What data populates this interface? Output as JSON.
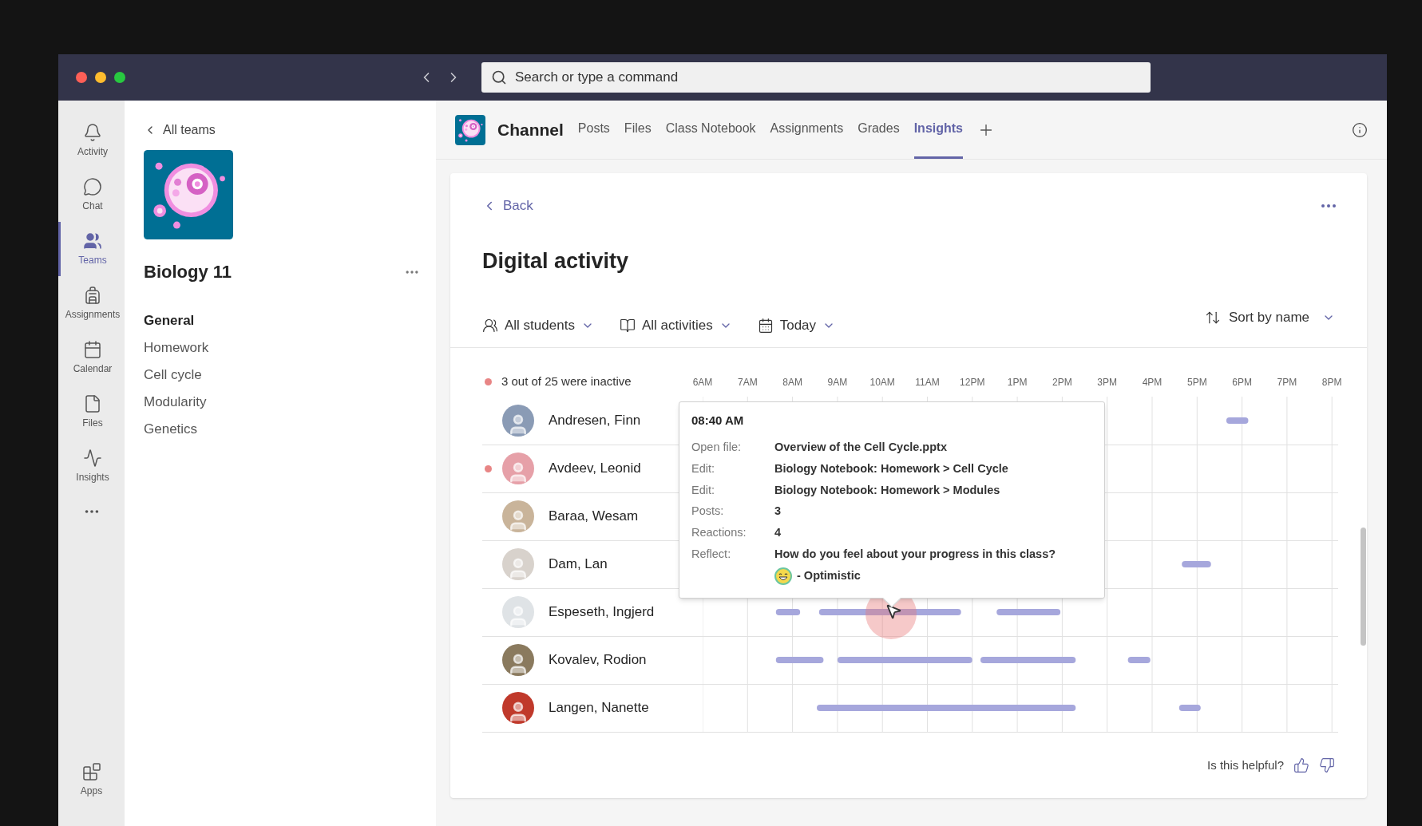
{
  "search": {
    "placeholder": "Search or type a command"
  },
  "rail": {
    "items": [
      {
        "label": "Activity",
        "kind": "bell",
        "selected": false
      },
      {
        "label": "Chat",
        "kind": "chat",
        "selected": false
      },
      {
        "label": "Teams",
        "kind": "teams",
        "selected": true
      },
      {
        "label": "Assignments",
        "kind": "backpack",
        "selected": false
      },
      {
        "label": "Calendar",
        "kind": "calendar",
        "selected": false
      },
      {
        "label": "Files",
        "kind": "file",
        "selected": false
      },
      {
        "label": "Insights",
        "kind": "pulse",
        "selected": false
      }
    ],
    "bottom": {
      "label": "Apps"
    }
  },
  "team": {
    "back": "All teams",
    "name": "Biology 11",
    "channels": [
      {
        "label": "General",
        "selected": true
      },
      {
        "label": "Homework",
        "selected": false
      },
      {
        "label": "Cell cycle",
        "selected": false
      },
      {
        "label": "Modularity",
        "selected": false
      },
      {
        "label": "Genetics",
        "selected": false
      }
    ]
  },
  "header": {
    "title": "Channel",
    "tabs": [
      {
        "label": "Posts",
        "selected": false
      },
      {
        "label": "Files",
        "selected": false
      },
      {
        "label": "Class Notebook",
        "selected": false
      },
      {
        "label": "Assignments",
        "selected": false
      },
      {
        "label": "Grades",
        "selected": false
      },
      {
        "label": "Insights",
        "selected": true
      }
    ]
  },
  "card": {
    "back": "Back",
    "title": "Digital activity",
    "filters": [
      {
        "label": "All students",
        "kind": "students"
      },
      {
        "label": "All activities",
        "kind": "activities"
      },
      {
        "label": "Today",
        "kind": "date"
      }
    ],
    "sort": "Sort by name",
    "summary": "3 out of 25 were inactive",
    "hours": [
      "6AM",
      "7AM",
      "8AM",
      "9AM",
      "10AM",
      "11AM",
      "12PM",
      "1PM",
      "2PM",
      "3PM",
      "4PM",
      "5PM",
      "6PM",
      "7PM",
      "8PM"
    ],
    "students": [
      {
        "name": "Andresen, Finn",
        "inactive": false,
        "color": "#8a9bb5"
      },
      {
        "name": "Avdeev, Leonid",
        "inactive": true,
        "color": "#e6a0a8"
      },
      {
        "name": "Baraa, Wesam",
        "inactive": false,
        "color": "#c9b49a"
      },
      {
        "name": "Dam, Lan",
        "inactive": false,
        "color": "#d8d2cc"
      },
      {
        "name": "Espeseth, Ingjerd",
        "inactive": false,
        "color": "#dfe3e6"
      },
      {
        "name": "Kovalev, Rodion",
        "inactive": false,
        "color": "#8a7a5e"
      },
      {
        "name": "Langen, Nanette",
        "inactive": false,
        "color": "#c0392b"
      }
    ],
    "tooltip": {
      "time": "08:40 AM",
      "rows": [
        {
          "label": "Open file:",
          "value": "Overview of the Cell Cycle.pptx"
        },
        {
          "label": "Edit:",
          "value": "Biology Notebook: Homework > Cell Cycle"
        },
        {
          "label": "Edit:",
          "value": "Biology Notebook: Homework > Modules"
        },
        {
          "label": "Posts:",
          "value": "3"
        },
        {
          "label": "Reactions:",
          "value": "4"
        },
        {
          "label": "Reflect:",
          "value": "How do you feel about your progress in this class?",
          "response": "- Optimistic"
        }
      ]
    },
    "feedback": "Is this helpful?"
  }
}
